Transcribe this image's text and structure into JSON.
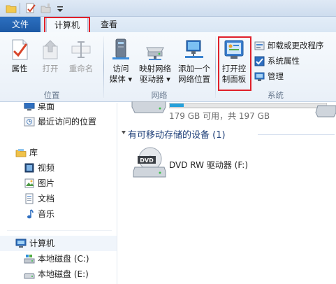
{
  "tabs": {
    "file": "文件",
    "computer": "计算机",
    "view": "查看"
  },
  "ribbon": {
    "location": {
      "label": "位置",
      "properties": "属性",
      "open": "打开",
      "rename": "重命名"
    },
    "network": {
      "label": "网络",
      "access_media_line1": "访问",
      "access_media_line2": "媒体",
      "map_drive_line1": "映射网络",
      "map_drive_line2": "驱动器",
      "add_location_line1": "添加一个",
      "add_location_line2": "网络位置"
    },
    "system": {
      "label": "系统",
      "control_panel_line1": "打开控",
      "control_panel_line2": "制面板",
      "uninstall": "卸载或更改程序",
      "system_properties": "系统属性",
      "manage": "管理"
    }
  },
  "nav": {
    "desktop": "桌面",
    "recent": "最近访问的位置",
    "libraries": "库",
    "videos": "视频",
    "pictures": "图片",
    "documents": "文档",
    "music": "音乐",
    "computer": "计算机",
    "disk_c": "本地磁盘 (C:)",
    "disk_e": "本地磁盘 (E:)"
  },
  "content": {
    "disk_space": "179 GB 可用，共 197 GB",
    "removable_header": "有可移动存储的设备 (1)",
    "dvd_drive": "DVD RW 驱动器 (F:)",
    "dvd_badge": "DVD"
  }
}
